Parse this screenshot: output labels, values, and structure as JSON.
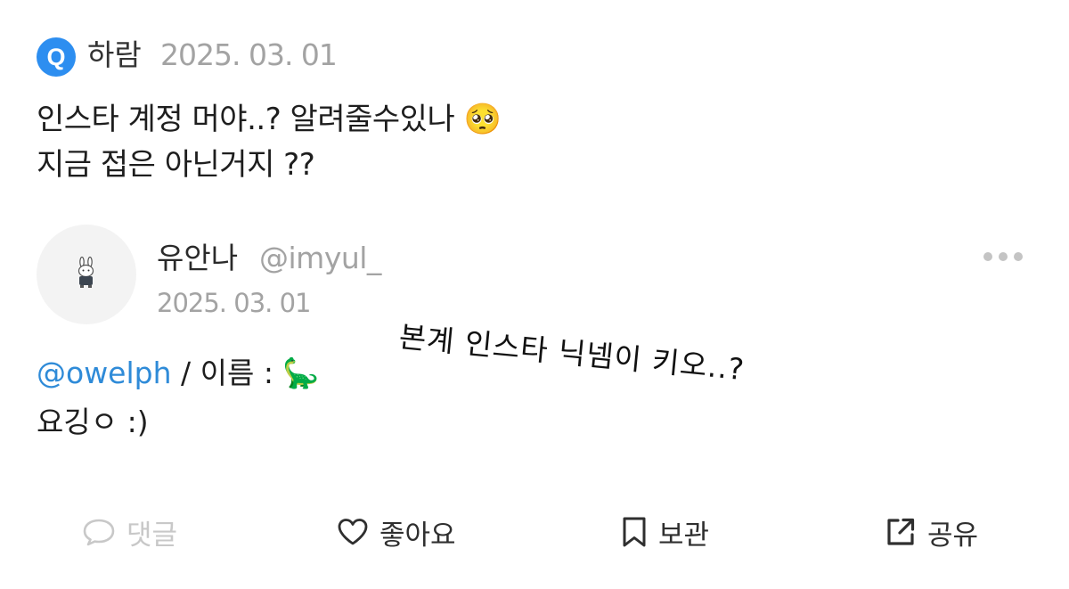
{
  "question": {
    "badge_label": "Q",
    "author": "하람",
    "date": "2025. 03. 01",
    "lines": [
      "인스타 계정 머야..? 알려줄수있나 🥺",
      "지금 접은 아닌거지 ??"
    ]
  },
  "answer": {
    "avatar_icon": "bunny-avatar-icon",
    "name": "유안나",
    "handle": "@imyul_",
    "date": "2025. 03. 01",
    "mention": "@owelph",
    "line1_rest": " / 이름 : 🦕",
    "line2": "요깅ㅇ :)"
  },
  "overlay_note": "본계 인스타 닉넴이 키오..?",
  "actions": {
    "comment": "댓글",
    "like": "좋아요",
    "save": "보관",
    "share": "공유"
  },
  "colors": {
    "badge": "#2d8ef0",
    "mention": "#2f8bd8",
    "muted": "#a3a3a3",
    "disabled": "#c8c8c8"
  }
}
